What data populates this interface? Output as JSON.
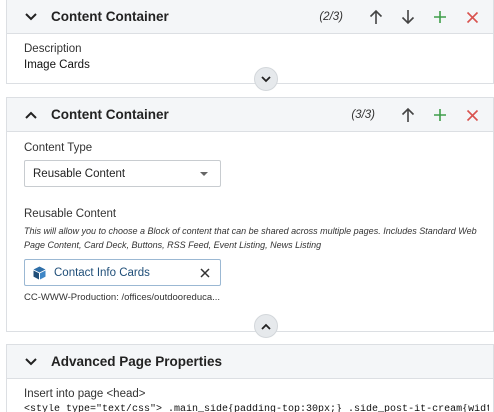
{
  "panel1": {
    "title": "Content Container",
    "count": "(2/3)",
    "field_label": "Description",
    "field_value": "Image Cards"
  },
  "panel2": {
    "title": "Content Container",
    "count": "(3/3)",
    "content_type_label": "Content Type",
    "content_type_value": "Reusable Content",
    "reusable_label": "Reusable Content",
    "reusable_help": "This will allow you to choose a Block of content that can be shared across multiple pages. Includes Standard Web Page Content, Card Deck, Buttons, RSS Feed, Event Listing, News Listing",
    "selected_block": "Contact Info Cards",
    "selected_path": "CC-WWW-Production: /offices/outdooreduca..."
  },
  "panel3": {
    "title": "Advanced Page Properties",
    "head_label": "Insert into page <head>",
    "head_value": "<style type=\"text/css\">  .main_side{padding-top:30px;} .side_post-it-cream{width:210px;lim"
  },
  "colors": {
    "arrow": "#444444",
    "add": "#3f9e4a",
    "remove": "#d9534f",
    "link": "#1f4e78"
  },
  "icons": [
    "chevron-down-icon",
    "chevron-up-icon",
    "arrow-up-icon",
    "arrow-down-icon",
    "plus-icon",
    "close-icon",
    "cube-icon"
  ]
}
